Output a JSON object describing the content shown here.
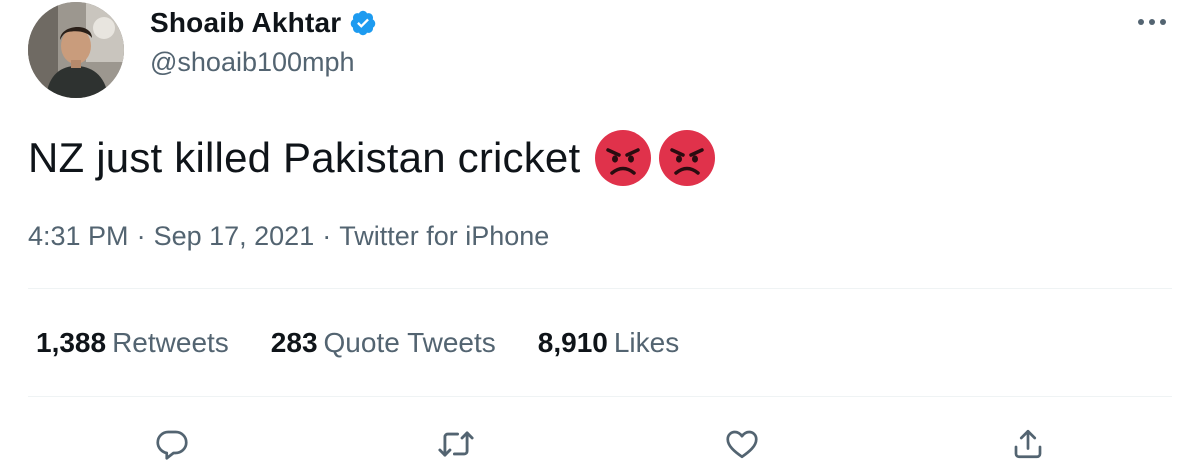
{
  "user": {
    "display_name": "Shoaib Akhtar",
    "handle": "@shoaib100mph",
    "verified": true,
    "avatar_icon": "profile-photo"
  },
  "tweet": {
    "text": "NZ just killed Pakistan cricket",
    "emojis": [
      "angry-face",
      "angry-face"
    ]
  },
  "meta": {
    "time": "4:31 PM",
    "separator": "·",
    "date": "Sep 17, 2021",
    "source": "Twitter for iPhone"
  },
  "stats": {
    "retweets": {
      "count": "1,388",
      "label": "Retweets"
    },
    "quotes": {
      "count": "283",
      "label": "Quote Tweets"
    },
    "likes": {
      "count": "8,910",
      "label": "Likes"
    }
  },
  "actions": [
    "reply-icon",
    "retweet-icon",
    "like-icon",
    "share-icon"
  ],
  "colors": {
    "text": "#0f1419",
    "secondary": "#536471",
    "verified": "#1d9bf0",
    "emoji": "#e0324b",
    "divider": "#eff3f4"
  }
}
